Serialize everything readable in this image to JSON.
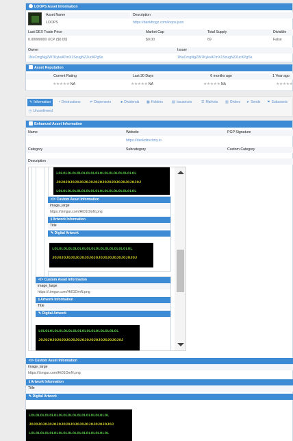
{
  "asset_info": {
    "title": "LOOPS Asset Information",
    "asset_name_label": "Asset Name",
    "asset_name": "LOOPS",
    "description_label": "Description",
    "description": "https://dankfrogz.com/loops.json",
    "last_trade_label": "Last DEX Trade Price",
    "last_trade": "0.00000000 XCP ($0.00)",
    "market_cap_label": "Market Cap",
    "market_cap": "$0.00",
    "total_supply_label": "Total Supply",
    "total_supply": "69",
    "divisible_label": "Divisible",
    "divisible": "False",
    "owner_label": "Owner",
    "owner": "1NuCmgNgZW7KykvATmX1SzugNZZucKPgSs",
    "issuer_label": "Issuer",
    "issuer": "1NuCmgNgZW7KykvATmX1SzugNZZucKPgSs"
  },
  "reputation": {
    "title": "Asset Reputation",
    "columns": [
      "Current Rating",
      "Last 30 Days",
      "6 months ago",
      "1 Year ago"
    ],
    "stars": "★★★★★",
    "na": "NA"
  },
  "tabs": [
    {
      "label": "Information",
      "icon": "info-icon",
      "glyph": "✎"
    },
    {
      "label": "Destructions",
      "icon": "trash-icon",
      "glyph": "🗑"
    },
    {
      "label": "Dispensers",
      "icon": "dispenser-icon",
      "glyph": "⇌"
    },
    {
      "label": "Dividends",
      "icon": "dividend-icon",
      "glyph": "♣"
    },
    {
      "label": "Holders",
      "icon": "holders-icon",
      "glyph": "▦"
    },
    {
      "label": "Issuances",
      "icon": "issuance-icon",
      "glyph": "▤"
    },
    {
      "label": "Markets",
      "icon": "markets-icon",
      "glyph": "☰"
    },
    {
      "label": "Orders",
      "icon": "orders-icon",
      "glyph": "▥"
    },
    {
      "label": "Sends",
      "icon": "send-icon",
      "glyph": "➤"
    },
    {
      "label": "Subassets",
      "icon": "subassets-icon",
      "glyph": "⚑"
    },
    {
      "label": "Unconfirmed",
      "icon": "clock-icon",
      "glyph": "◷"
    }
  ],
  "enhanced": {
    "title": "Enhanced Asset Information",
    "name_label": "Name",
    "website_label": "Website",
    "website": "https://dankdirectory.io",
    "pgp_label": "PGP Signature",
    "category_label": "Category",
    "subcategory_label": "Subcategory",
    "custom_category_label": "Custom Category",
    "description_label": "Description"
  },
  "custom": {
    "title": "Custom Asset Information",
    "image_label": "image_large",
    "image_url": "https://i.imgur.com/Ht01OmN.png",
    "artwork_title": "Artwork Information",
    "title_label": "Title",
    "digital_artwork_title": "Digital Artwork"
  },
  "art": {
    "line_a": "LOLOLOLOLOLOLOLOLOLOLOLOLOLOLOLOLOL",
    "line_b": "JOJOJOJOJOJOJOJOJOJOJOJOJOJOJOJOJOJOJ"
  },
  "colors": {
    "accent": "#3d8bd4",
    "art_green": "#59c848",
    "art_yellow": "#d6d62a"
  }
}
